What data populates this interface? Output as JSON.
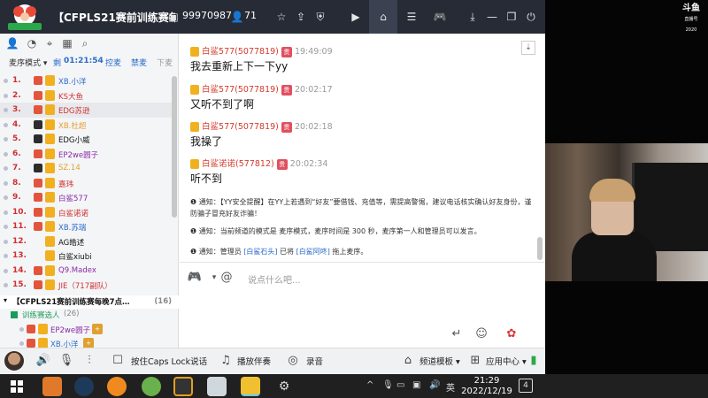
{
  "titlebar": {
    "channel_title": "【CFPLS21赛前训练赛每…",
    "channel_id": "99970987",
    "online_count": "71"
  },
  "sidebar": {
    "mode_label": "麦序模式",
    "remaining_label": "剩",
    "remaining_time": "01:21:54",
    "control_label": "控麦",
    "ban_label": "禁麦",
    "down_label": "下麦",
    "queue": [
      {
        "num": "1.",
        "name": "XB.小洋",
        "color": "#2a6bc9",
        "badge": "#e2553c"
      },
      {
        "num": "2.",
        "name": "KS大鱼",
        "color": "#d03030",
        "badge": "#e2553c"
      },
      {
        "num": "3.",
        "name": "EDG苏逊",
        "color": "#d03030",
        "badge": "#e2553c"
      },
      {
        "num": "4.",
        "name": "XB.杜超",
        "color": "#e0a030",
        "badge": "#2d2d2d"
      },
      {
        "num": "5.",
        "name": "EDG小威",
        "color": "#111111",
        "badge": "#2d2d2d"
      },
      {
        "num": "6.",
        "name": "EP2we圆子",
        "color": "#8a2aa8",
        "badge": "#e2553c"
      },
      {
        "num": "7.",
        "name": "SZ.14",
        "color": "#e0a030",
        "badge": "#2d2d2d"
      },
      {
        "num": "8.",
        "name": "嘉玮",
        "color": "#d03030",
        "badge": "#e2553c"
      },
      {
        "num": "9.",
        "name": "白鲨577",
        "color": "#8a2aa8",
        "badge": "#e2553c"
      },
      {
        "num": "10.",
        "name": "白鲨诺诺",
        "color": "#d03030",
        "badge": "#e2553c"
      },
      {
        "num": "11.",
        "name": "XB.苏瑞",
        "color": "#2a6bc9",
        "badge": "#e2553c"
      },
      {
        "num": "12.",
        "name": "AG皓述",
        "color": "#111111",
        "badge": ""
      },
      {
        "num": "13.",
        "name": "白鲨xiubi",
        "color": "#111111",
        "badge": ""
      },
      {
        "num": "14.",
        "name": "Q9.Madex",
        "color": "#8a2aa8",
        "badge": "#e2553c"
      },
      {
        "num": "15.",
        "name": "JIE（717副队）",
        "color": "#d03030",
        "badge": "#e2553c"
      }
    ],
    "channel_row": "【CFPLS21赛前训练赛每晚7点…",
    "channel_row_count": "(16)",
    "training_row": "训练赛选人",
    "training_count": "(26)",
    "sub_users": [
      {
        "name": "EP2we圆子"
      },
      {
        "name": "XB.小洋"
      }
    ]
  },
  "chat": {
    "messages": [
      {
        "name": "白鲨577(5077819)",
        "grade": "贵",
        "time": "19:49:09",
        "text": "我去重新上下一下yy"
      },
      {
        "name": "白鲨577(5077819)",
        "grade": "贵",
        "time": "20:02:17",
        "text": "又听不到了啊"
      },
      {
        "name": "白鲨577(5077819)",
        "grade": "贵",
        "time": "20:02:18",
        "text": "我操了"
      },
      {
        "name": "白鲨诺诺(577812)",
        "grade": "贵",
        "time": "20:02:34",
        "text": "听不到"
      }
    ],
    "notices": [
      {
        "prefix": "通知：",
        "text": "【YY安全提醒】在YY上若遇到“好友”要借钱、充值等，需提高警惕，建议电话核实确认好友身份，谨防骗子冒充好友诈骗！"
      },
      {
        "prefix": "通知：",
        "text": "当前频道的模式是 麦序模式，麦序时间是 300 秒，麦序第一人和管理员可以发言。"
      },
      {
        "prefix": "通知：",
        "text_before": "管理员 ",
        "hl1": "[白鲨石头]",
        "text_mid": " 已将 ",
        "hl2": "[白鲨阿咚]",
        "text_after": " 拖上麦序。"
      }
    ]
  },
  "input": {
    "placeholder": "说点什么吧..."
  },
  "bottombar": {
    "capslock_label": "按住Caps Lock说话",
    "accompany_label": "播放伴奏",
    "record_label": "录音",
    "template_label": "频道模板",
    "app_center_label": "应用中心"
  },
  "overlay": {
    "douyu": "斗鱼",
    "douyu_sub": "直播号",
    "douyu_year": "2020"
  },
  "taskbar": {
    "time": "21:29",
    "date": "2022/12/19",
    "lang": "英",
    "notif_count": "4"
  }
}
